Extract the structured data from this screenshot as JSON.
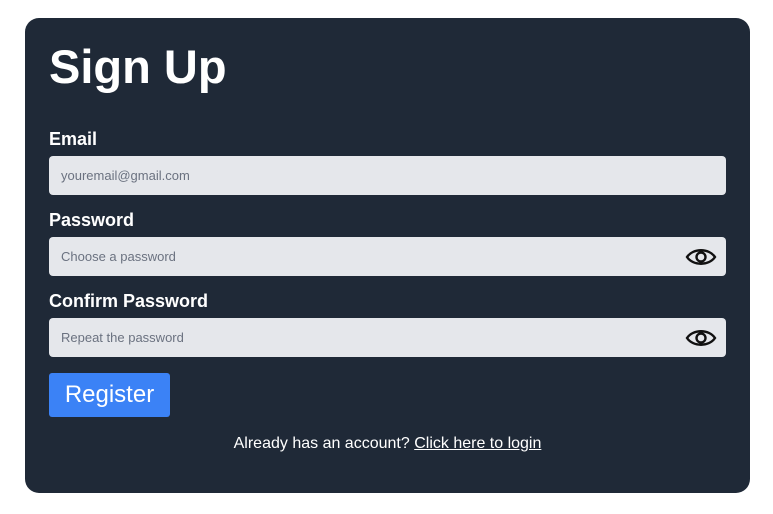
{
  "form": {
    "title": "Sign Up",
    "email": {
      "label": "Email",
      "placeholder": "youremail@gmail.com",
      "value": ""
    },
    "password": {
      "label": "Password",
      "placeholder": "Choose a password",
      "value": ""
    },
    "confirm_password": {
      "label": "Confirm Password",
      "placeholder": "Repeat the password",
      "value": ""
    },
    "register_label": "Register",
    "footer_text": "Already has an account?",
    "login_link": "Click here to login"
  },
  "icons": {
    "password_toggle": "eye-icon",
    "confirm_toggle": "eye-icon"
  },
  "colors": {
    "card_background": "#1f2937",
    "input_background": "#e5e7eb",
    "button_background": "#3b82f6",
    "text": "#ffffff"
  }
}
